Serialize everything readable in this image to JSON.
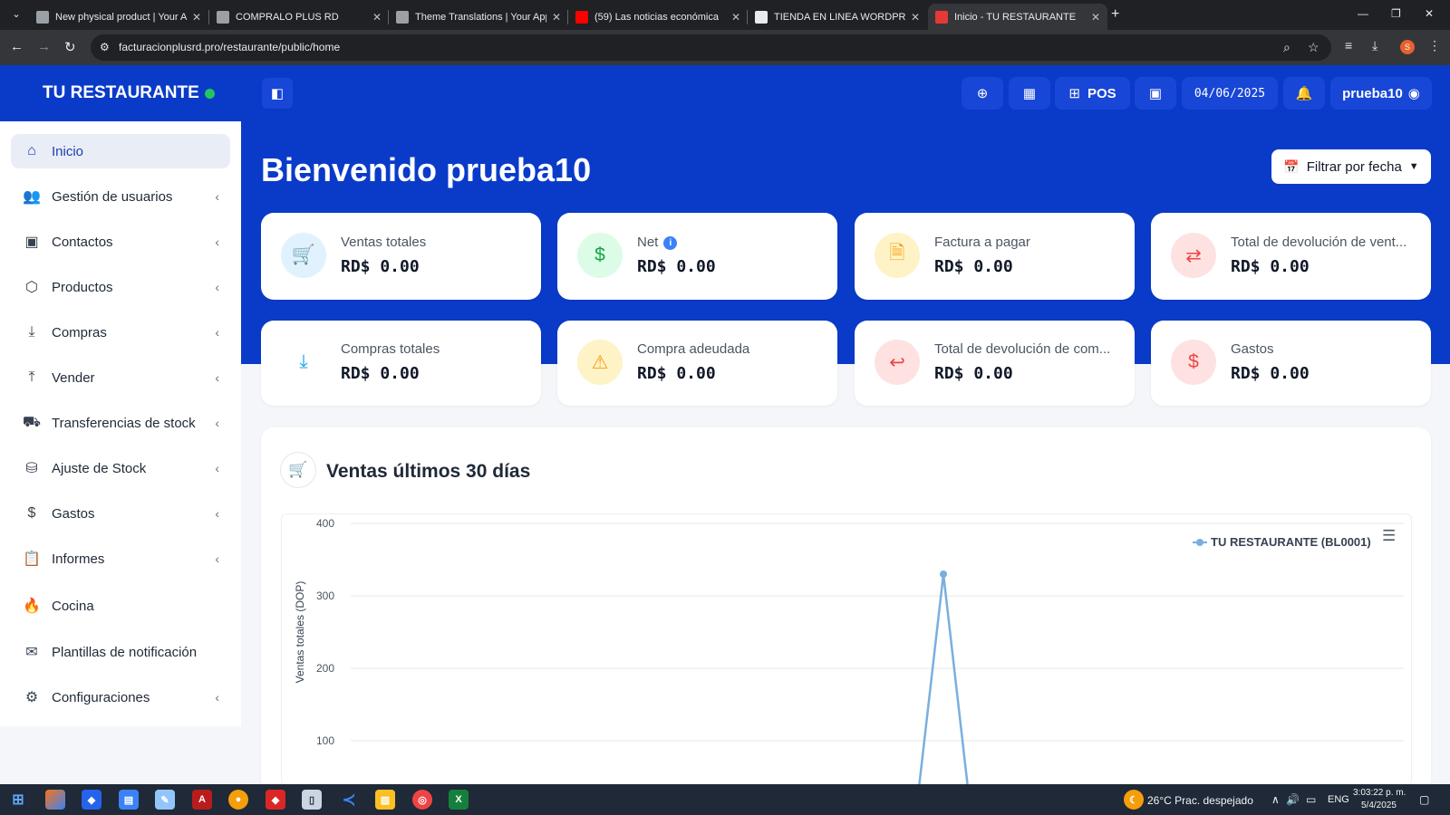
{
  "browser": {
    "tabs": [
      {
        "title": "New physical product | Your Ap",
        "favicon_color": "#9aa0a6"
      },
      {
        "title": "COMPRALO PLUS RD",
        "favicon_color": "#9aa0a6"
      },
      {
        "title": "Theme Translations | Your Appd",
        "favicon_color": "#9aa0a6"
      },
      {
        "title": "(59) Las noticias económica",
        "favicon_color": "#ff0000"
      },
      {
        "title": "TIENDA EN LINEA WORDPRESS",
        "favicon_color": "#e8eaed"
      },
      {
        "title": "Inicio - TU RESTAURANTE",
        "favicon_color": "#e53935"
      }
    ],
    "url": "facturacionplusrd.pro/restaurante/public/home",
    "profile_initial": "S"
  },
  "app": {
    "brand": "TU RESTAURANTE",
    "pos_label": "POS",
    "date": "04/06/2025",
    "username": "prueba10",
    "welcome": "Bienvenido prueba10",
    "filter_label": "Filtrar por fecha"
  },
  "sidebar": {
    "items": [
      {
        "label": "Inicio",
        "icon": "home-icon",
        "glyph": "⌂",
        "active": true,
        "chevron": false
      },
      {
        "label": "Gestión de usuarios",
        "icon": "users-icon",
        "glyph": "👥",
        "chevron": true
      },
      {
        "label": "Contactos",
        "icon": "contacts-icon",
        "glyph": "▣",
        "chevron": true
      },
      {
        "label": "Productos",
        "icon": "box-icon",
        "glyph": "⬡",
        "chevron": true
      },
      {
        "label": "Compras",
        "icon": "download-icon",
        "glyph": "⤓",
        "chevron": true
      },
      {
        "label": "Vender",
        "icon": "upload-icon",
        "glyph": "⤒",
        "chevron": true
      },
      {
        "label": "Transferencias de stock",
        "icon": "truck-icon",
        "glyph": "⛟",
        "chevron": true
      },
      {
        "label": "Ajuste de Stock",
        "icon": "database-icon",
        "glyph": "⛁",
        "chevron": true
      },
      {
        "label": "Gastos",
        "icon": "receipt-icon",
        "glyph": "$",
        "chevron": true
      },
      {
        "label": "Informes",
        "icon": "clipboard-icon",
        "glyph": "📋",
        "chevron": true
      },
      {
        "label": "Cocina",
        "icon": "flame-icon",
        "glyph": "🔥",
        "chevron": false
      },
      {
        "label": "Plantillas de notificación",
        "icon": "mail-icon",
        "glyph": "✉",
        "chevron": false
      },
      {
        "label": "Configuraciones",
        "icon": "gear-icon",
        "glyph": "⚙",
        "chevron": true
      }
    ]
  },
  "stats": [
    {
      "title": "Ventas totales",
      "value": "RD$ 0.00",
      "icon": "cart-icon",
      "glyph": "🛒",
      "bg": "#e0f2fe",
      "fg": "#0ea5e9"
    },
    {
      "title": "Net",
      "value": "RD$ 0.00",
      "icon": "dollar-receipt-icon",
      "glyph": "$",
      "bg": "#dcfce7",
      "fg": "#16a34a",
      "info": "i"
    },
    {
      "title": "Factura a pagar",
      "value": "RD$ 0.00",
      "icon": "invoice-icon",
      "glyph": "🗎",
      "bg": "#fef3c7",
      "fg": "#f59e0b"
    },
    {
      "title": "Total de devolución de vent...",
      "value": "RD$ 0.00",
      "icon": "swap-icon",
      "glyph": "⇄",
      "bg": "#fee2e2",
      "fg": "#ef4444"
    },
    {
      "title": "Compras totales",
      "value": "RD$ 0.00",
      "icon": "download-icon",
      "glyph": "⤓",
      "bg": "#ffffff",
      "fg": "#0ea5e9"
    },
    {
      "title": "Compra adeudada",
      "value": "RD$ 0.00",
      "icon": "warning-icon",
      "glyph": "⚠",
      "bg": "#fef3c7",
      "fg": "#f59e0b"
    },
    {
      "title": "Total de devolución de com...",
      "value": "RD$ 0.00",
      "icon": "return-receipt-icon",
      "glyph": "↩",
      "bg": "#fee2e2",
      "fg": "#ef4444"
    },
    {
      "title": "Gastos",
      "value": "RD$ 0.00",
      "icon": "expense-icon",
      "glyph": "$",
      "bg": "#fee2e2",
      "fg": "#ef4444"
    }
  ],
  "chart": {
    "heading": "Ventas últimos 30 días"
  },
  "chart_data": {
    "type": "line",
    "ylabel": "Ventas totales (DOP)",
    "ylim": [
      0,
      400
    ],
    "yticks": [
      100,
      200,
      300,
      400
    ],
    "grid": true,
    "legend_position": "top-right",
    "series": [
      {
        "name": "TU RESTAURANTE (BL0001)",
        "color": "#7aaee0",
        "values": [
          0,
          0,
          0,
          0,
          0,
          0,
          0,
          0,
          0,
          0,
          0,
          0,
          0,
          0,
          0,
          0,
          0,
          0,
          0,
          0,
          0,
          330,
          0,
          0,
          0,
          0,
          0,
          0,
          0,
          0
        ]
      }
    ]
  },
  "taskbar": {
    "weather": "26°C  Prac. despejado",
    "lang": "ENG",
    "time": "3:03:22 p. m.",
    "date": "5/4/2025"
  }
}
